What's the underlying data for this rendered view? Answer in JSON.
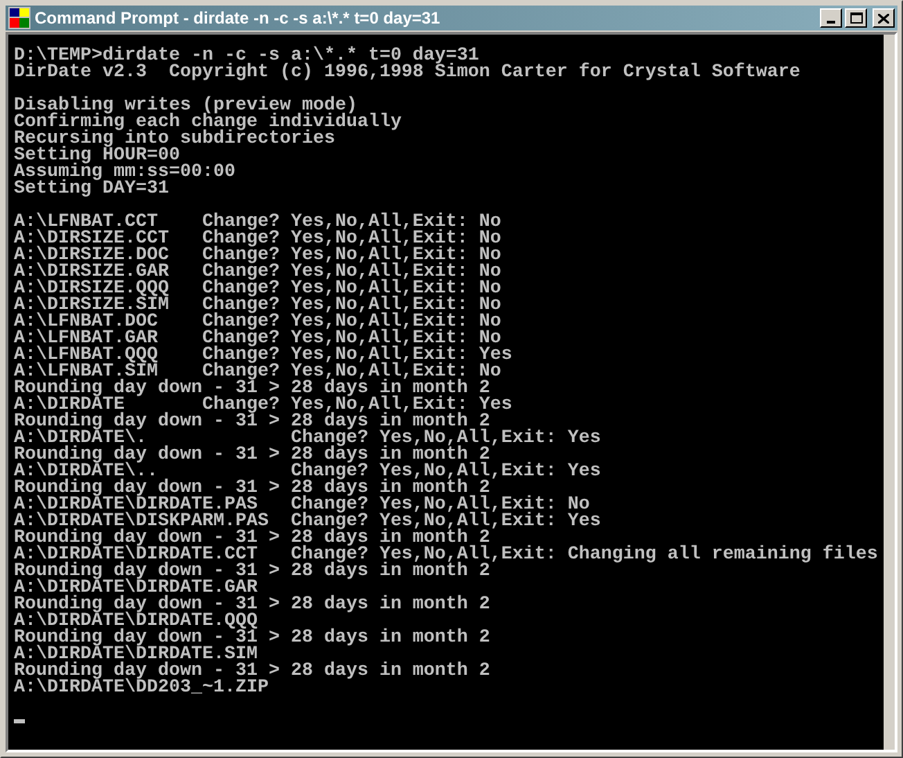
{
  "window": {
    "title": "Command Prompt - dirdate -n -c -s a:\\*.* t=0 day=31"
  },
  "console": {
    "blocks": [
      [
        "D:\\TEMP>dirdate -n -c -s a:\\*.* t=0 day=31",
        "DirDate v2.3  Copyright (c) 1996,1998 Simon Carter for Crystal Software"
      ],
      [
        "Disabling writes (preview mode)",
        "Confirming each change individually",
        "Recursing into subdirectories",
        "Setting HOUR=00",
        "Assuming mm:ss=00:00",
        "Setting DAY=31"
      ],
      [
        "A:\\LFNBAT.CCT    Change? Yes,No,All,Exit: No",
        "A:\\DIRSIZE.CCT   Change? Yes,No,All,Exit: No",
        "A:\\DIRSIZE.DOC   Change? Yes,No,All,Exit: No",
        "A:\\DIRSIZE.GAR   Change? Yes,No,All,Exit: No",
        "A:\\DIRSIZE.QQQ   Change? Yes,No,All,Exit: No",
        "A:\\DIRSIZE.SIM   Change? Yes,No,All,Exit: No",
        "A:\\LFNBAT.DOC    Change? Yes,No,All,Exit: No",
        "A:\\LFNBAT.GAR    Change? Yes,No,All,Exit: No",
        "A:\\LFNBAT.QQQ    Change? Yes,No,All,Exit: Yes",
        "A:\\LFNBAT.SIM    Change? Yes,No,All,Exit: No",
        "Rounding day down - 31 > 28 days in month 2",
        "A:\\DIRDATE       Change? Yes,No,All,Exit: Yes",
        "Rounding day down - 31 > 28 days in month 2",
        "A:\\DIRDATE\\.             Change? Yes,No,All,Exit: Yes",
        "Rounding day down - 31 > 28 days in month 2",
        "A:\\DIRDATE\\..            Change? Yes,No,All,Exit: Yes",
        "Rounding day down - 31 > 28 days in month 2",
        "A:\\DIRDATE\\DIRDATE.PAS   Change? Yes,No,All,Exit: No",
        "A:\\DIRDATE\\DISKPARM.PAS  Change? Yes,No,All,Exit: Yes",
        "Rounding day down - 31 > 28 days in month 2",
        "A:\\DIRDATE\\DIRDATE.CCT   Change? Yes,No,All,Exit: Changing all remaining files",
        "Rounding day down - 31 > 28 days in month 2",
        "A:\\DIRDATE\\DIRDATE.GAR",
        "Rounding day down - 31 > 28 days in month 2",
        "A:\\DIRDATE\\DIRDATE.QQQ",
        "Rounding day down - 31 > 28 days in month 2",
        "A:\\DIRDATE\\DIRDATE.SIM",
        "Rounding day down - 31 > 28 days in month 2",
        "A:\\DIRDATE\\DD203_~1.ZIP"
      ]
    ]
  }
}
